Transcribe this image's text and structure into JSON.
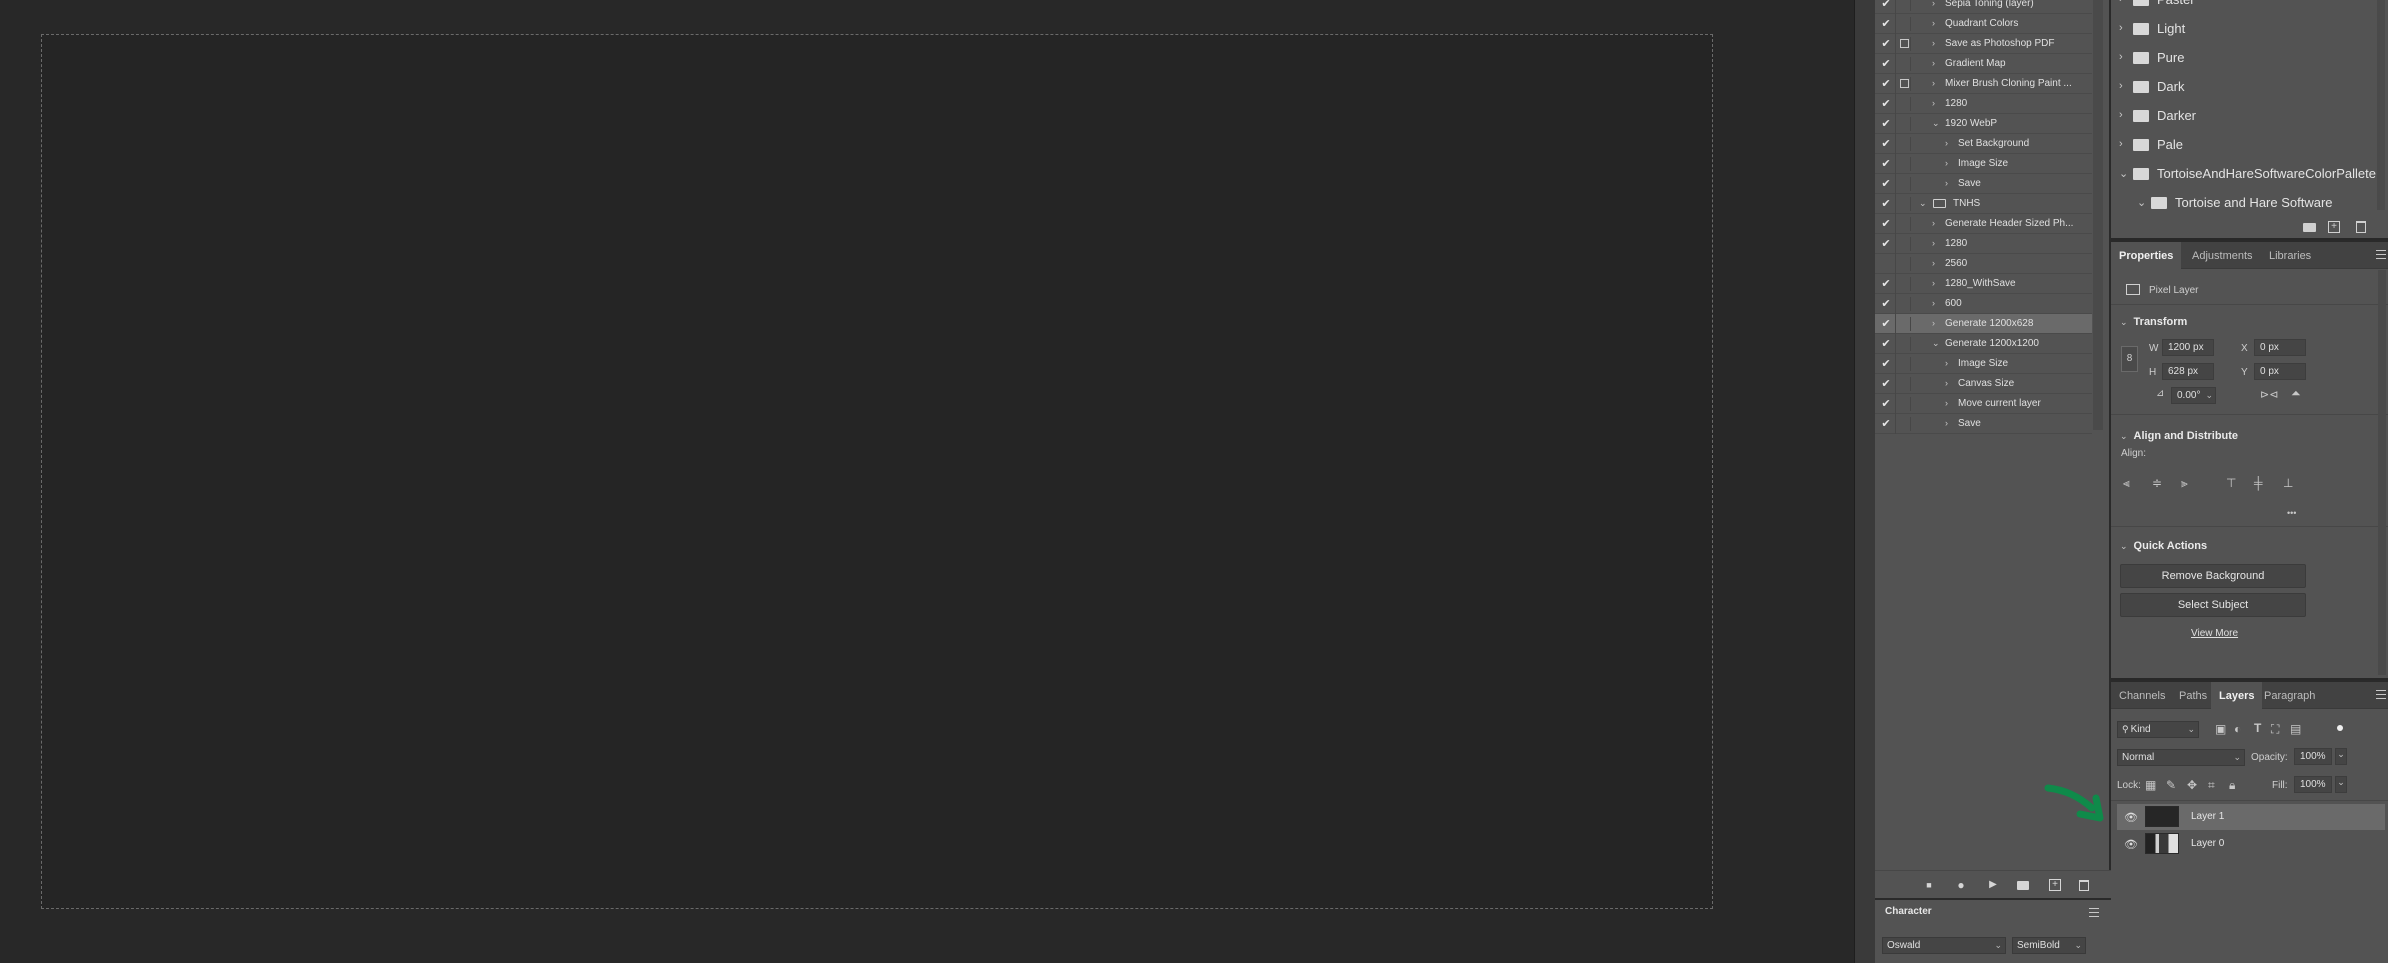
{
  "actions": {
    "items": [
      {
        "checked": true,
        "dialog": false,
        "indent": 1,
        "twisty": "›",
        "label": "Sepia Toning (layer)"
      },
      {
        "checked": true,
        "dialog": false,
        "indent": 1,
        "twisty": "›",
        "label": "Quadrant Colors"
      },
      {
        "checked": true,
        "dialog": true,
        "indent": 1,
        "twisty": "›",
        "label": "Save as Photoshop PDF"
      },
      {
        "checked": true,
        "dialog": false,
        "indent": 1,
        "twisty": "›",
        "label": "Gradient Map"
      },
      {
        "checked": true,
        "dialog": true,
        "indent": 1,
        "twisty": "›",
        "label": "Mixer Brush Cloning Paint ..."
      },
      {
        "checked": true,
        "dialog": false,
        "indent": 1,
        "twisty": "›",
        "label": "1280"
      },
      {
        "checked": true,
        "dialog": false,
        "indent": 1,
        "twisty": "⌄",
        "label": "1920 WebP"
      },
      {
        "checked": true,
        "dialog": false,
        "indent": 2,
        "twisty": "›",
        "label": "Set Background"
      },
      {
        "checked": true,
        "dialog": false,
        "indent": 2,
        "twisty": "›",
        "label": "Image Size"
      },
      {
        "checked": true,
        "dialog": false,
        "indent": 2,
        "twisty": "›",
        "label": "Save"
      },
      {
        "checked": true,
        "dialog": false,
        "indent": 0,
        "twisty": "⌄",
        "label": "TNHS",
        "folder": true
      },
      {
        "checked": true,
        "dialog": false,
        "indent": 1,
        "twisty": "›",
        "label": "Generate Header Sized Ph..."
      },
      {
        "checked": true,
        "dialog": false,
        "indent": 1,
        "twisty": "›",
        "label": "1280"
      },
      {
        "checked": false,
        "dialog": false,
        "indent": 1,
        "twisty": "›",
        "label": "2560"
      },
      {
        "checked": true,
        "dialog": false,
        "indent": 1,
        "twisty": "›",
        "label": "1280_WithSave"
      },
      {
        "checked": true,
        "dialog": false,
        "indent": 1,
        "twisty": "›",
        "label": "600"
      },
      {
        "checked": true,
        "dialog": false,
        "indent": 1,
        "twisty": "›",
        "label": "Generate 1200x628",
        "selected": true
      },
      {
        "checked": true,
        "dialog": false,
        "indent": 1,
        "twisty": "⌄",
        "label": "Generate 1200x1200"
      },
      {
        "checked": true,
        "dialog": false,
        "indent": 2,
        "twisty": "›",
        "label": "Image Size"
      },
      {
        "checked": true,
        "dialog": false,
        "indent": 2,
        "twisty": "›",
        "label": "Canvas Size"
      },
      {
        "checked": true,
        "dialog": false,
        "indent": 2,
        "twisty": "›",
        "label": "Move current layer"
      },
      {
        "checked": true,
        "dialog": false,
        "indent": 2,
        "twisty": "›",
        "label": "Save"
      }
    ],
    "check_glyph": "✔",
    "toolbar": {
      "stop": "■",
      "record": "●",
      "play": "▶",
      "new_set": "folder",
      "new_action": "+",
      "delete": "🗑"
    }
  },
  "character": {
    "tab_label": "Character",
    "font_family": "Oswald",
    "font_style": "SemiBold"
  },
  "swatches": {
    "groups": [
      {
        "label": "Pastel",
        "twisty": "›",
        "indent": 0
      },
      {
        "label": "Light",
        "twisty": "›",
        "indent": 0
      },
      {
        "label": "Pure",
        "twisty": "›",
        "indent": 0
      },
      {
        "label": "Dark",
        "twisty": "›",
        "indent": 0
      },
      {
        "label": "Darker",
        "twisty": "›",
        "indent": 0
      },
      {
        "label": "Pale",
        "twisty": "›",
        "indent": 0
      },
      {
        "label": "TortoiseAndHareSoftwareColorPallete",
        "twisty": "⌄",
        "indent": 0
      },
      {
        "label": "Tortoise and Hare Software",
        "twisty": "⌄",
        "indent": 1
      }
    ]
  },
  "properties": {
    "tabs": [
      {
        "label": "Properties",
        "active": true
      },
      {
        "label": "Adjustments",
        "active": false
      },
      {
        "label": "Libraries",
        "active": false
      }
    ],
    "layer_type": "Pixel Layer",
    "transform": {
      "heading": "Transform",
      "w_label": "W",
      "w_value": "1200 px",
      "h_label": "H",
      "h_value": "628 px",
      "x_label": "X",
      "x_value": "0 px",
      "y_label": "Y",
      "y_value": "0 px",
      "angle": "0.00°"
    },
    "align": {
      "heading": "Align and Distribute",
      "align_label": "Align:",
      "more": "•••"
    },
    "quick_actions": {
      "heading": "Quick Actions",
      "remove_bg": "Remove Background",
      "select_subject": "Select Subject",
      "view_more": "View More"
    }
  },
  "layers": {
    "tabs": [
      {
        "label": "Channels",
        "active": false
      },
      {
        "label": "Paths",
        "active": false
      },
      {
        "label": "Layers",
        "active": true
      },
      {
        "label": "Paragraph",
        "active": false
      }
    ],
    "filter_kind": "Kind",
    "blend_mode": "Normal",
    "opacity_label": "Opacity:",
    "opacity_value": "100%",
    "lock_label": "Lock:",
    "fill_label": "Fill:",
    "fill_value": "100%",
    "items": [
      {
        "name": "Layer 1",
        "active": true
      },
      {
        "name": "Layer 0",
        "active": false
      }
    ]
  },
  "colors": {
    "panel": "#535353",
    "canvas": "#252525",
    "annotation_arrow": "#0f8a4a"
  }
}
